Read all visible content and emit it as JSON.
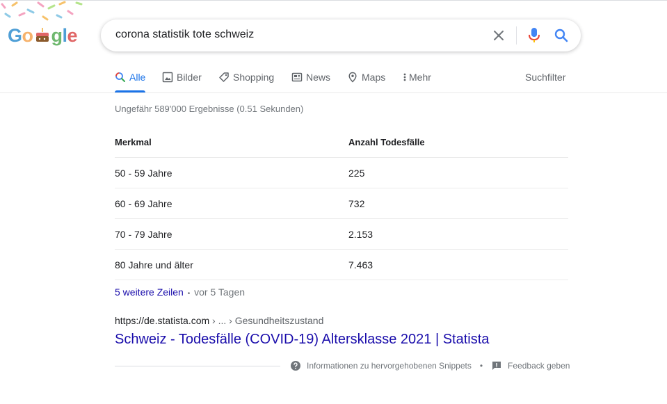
{
  "logo": {
    "letters": [
      "G",
      "o",
      "o",
      "g",
      "l",
      "e"
    ],
    "letter_colors": [
      "#4f9fd6",
      "#f6b26b",
      "#e06666",
      "#6fb86f",
      "#4f9fd6",
      "#e06666"
    ]
  },
  "search": {
    "query": "corona statistik tote schweiz"
  },
  "tabs": [
    {
      "label": "Alle",
      "icon": "search-icon"
    },
    {
      "label": "Bilder",
      "icon": "image-icon"
    },
    {
      "label": "Shopping",
      "icon": "tag-icon"
    },
    {
      "label": "News",
      "icon": "newspaper-icon"
    },
    {
      "label": "Maps",
      "icon": "location-pin-icon"
    },
    {
      "label": "Mehr",
      "icon": "more-vertical-icon"
    }
  ],
  "suchfilter": "Suchfilter",
  "result_stats": "Ungefähr 589'000 Ergebnisse (0.51 Sekunden)",
  "snippet_table": {
    "headers": [
      "Merkmal",
      "Anzahl Todesfälle"
    ],
    "rows": [
      [
        "50 - 59 Jahre",
        "225"
      ],
      [
        "60 - 69 Jahre",
        "732"
      ],
      [
        "70 - 79 Jahre",
        "2.153"
      ],
      [
        "80 Jahre und älter",
        "7.463"
      ]
    ]
  },
  "more_rows": {
    "link": "5 weitere Zeilen",
    "separator": "•",
    "date": "vor 5 Tagen"
  },
  "result": {
    "url": "https://de.statista.com",
    "path": " › ... › Gesundheitszustand",
    "title": "Schweiz - Todesfälle (COVID-19) Altersklasse 2021 | Statista"
  },
  "footer": {
    "info": "Informationen zu hervorgehobenen Snippets",
    "separator": "•",
    "feedback": "Feedback geben"
  },
  "colors": {
    "link": "#1a0dab",
    "accent": "#1a73e8",
    "muted": "#70757a"
  }
}
